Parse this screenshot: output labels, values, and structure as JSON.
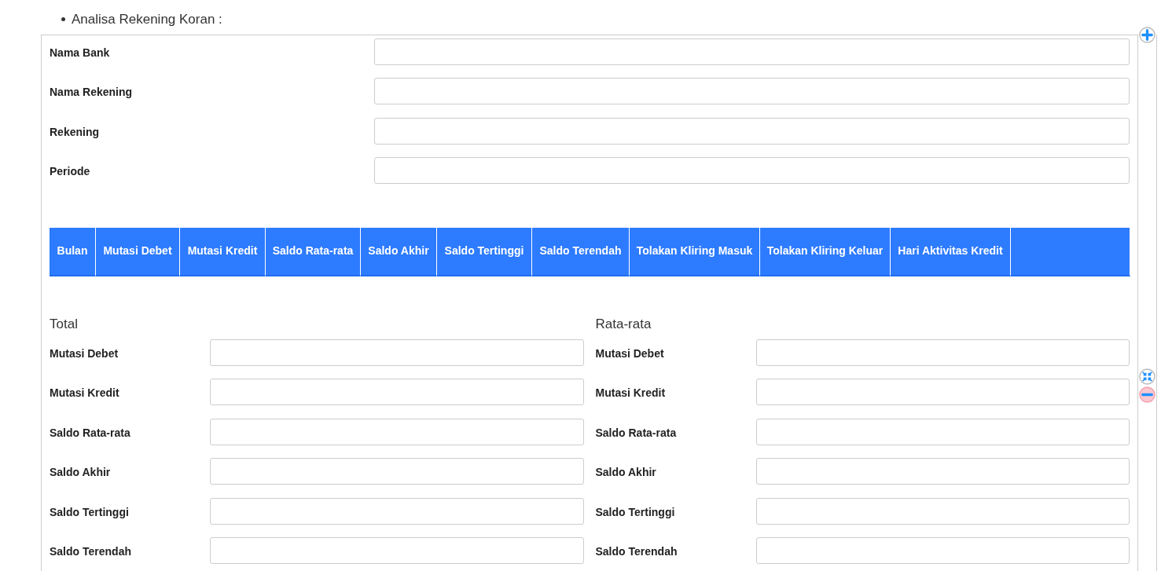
{
  "section_title": "Analisa Rekening Koran :",
  "account_fields": [
    {
      "label": "Nama Bank"
    },
    {
      "label": "Nama Rekening"
    },
    {
      "label": "Rekening"
    },
    {
      "label": "Periode"
    }
  ],
  "table": {
    "columns": [
      "Bulan",
      "Mutasi Debet",
      "Mutasi Kredit",
      "Saldo Rata-rata",
      "Saldo Akhir",
      "Saldo Tertinggi",
      "Saldo Terendah",
      "Tolakan Kliring Masuk",
      "Tolakan Kliring Keluar",
      "Hari Aktivitas Kredit",
      ""
    ]
  },
  "summaries": [
    {
      "title": "Total",
      "fields": [
        {
          "label": "Mutasi Debet"
        },
        {
          "label": "Mutasi Kredit"
        },
        {
          "label": "Saldo Rata-rata"
        },
        {
          "label": "Saldo Akhir"
        },
        {
          "label": "Saldo Tertinggi"
        },
        {
          "label": "Saldo Terendah"
        }
      ]
    },
    {
      "title": "Rata-rata",
      "fields": [
        {
          "label": "Mutasi Debet"
        },
        {
          "label": "Mutasi Kredit"
        },
        {
          "label": "Saldo Rata-rata"
        },
        {
          "label": "Saldo Akhir"
        },
        {
          "label": "Saldo Tertinggi"
        },
        {
          "label": "Saldo Terendah"
        }
      ]
    }
  ]
}
